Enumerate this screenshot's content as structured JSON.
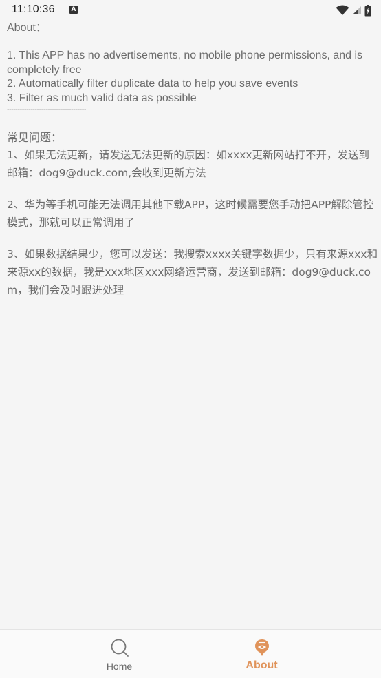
{
  "status_bar": {
    "time": "11:10:36",
    "notification_badge": "A"
  },
  "about": {
    "header": "About：",
    "features": [
      "1. This APP has no advertisements, no mobile phone permissions, and is completely free",
      "2. Automatically filter duplicate data to help you save events",
      "3. Filter as much valid data as possible"
    ],
    "divider": "-------------------------------------"
  },
  "faq": {
    "title": "常见问题：",
    "items": [
      "1、如果无法更新，请发送无法更新的原因：如xxxx更新网站打不开，发送到邮箱：dog9@duck.com,会收到更新方法",
      "2、华为等手机可能无法调用其他下载APP，这时候需要您手动把APP解除管控模式，那就可以正常调用了",
      "3、如果数据结果少，您可以发送：我搜索xxxx关键字数据少，只有来源xxx和来源xx的数据，我是xxx地区xxx网络运营商，发送到邮箱：dog9@duck.com，我们会及时跟进处理"
    ]
  },
  "bottom_nav": {
    "items": [
      {
        "label": "Home",
        "icon": "search-icon",
        "active": false
      },
      {
        "label": "About",
        "icon": "about-icon",
        "active": true
      }
    ]
  },
  "colors": {
    "accent": "#e0935a",
    "text": "#6b6b6b",
    "background": "#f5f5f5"
  }
}
